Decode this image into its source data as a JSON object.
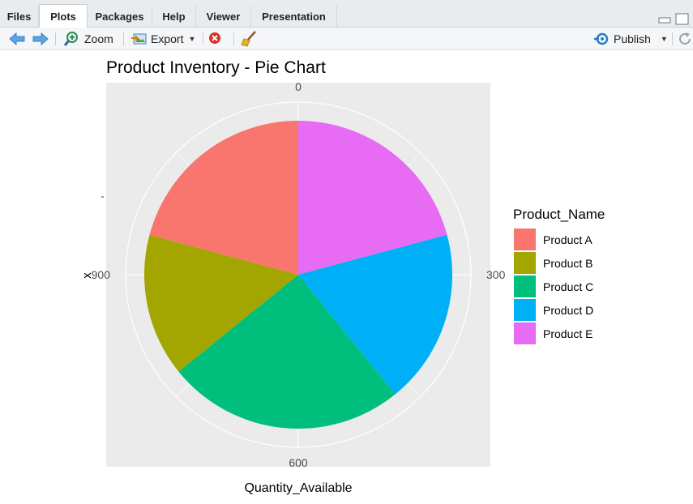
{
  "tabs": [
    {
      "label": "Files",
      "active": false
    },
    {
      "label": "Plots",
      "active": true
    },
    {
      "label": "Packages",
      "active": false
    },
    {
      "label": "Help",
      "active": false
    },
    {
      "label": "Viewer",
      "active": false
    },
    {
      "label": "Presentation",
      "active": false
    }
  ],
  "toolbar": {
    "zoom_label": "Zoom",
    "export_label": "Export",
    "publish_label": "Publish"
  },
  "chart_data": {
    "type": "pie",
    "title": "Product Inventory - Pie Chart",
    "xlabel": "Quantity_Available",
    "ylabel": "x",
    "y_tick_label": "1",
    "legend_title": "Product_Name",
    "legend_position": "right",
    "panel_background": "#ebebeb",
    "grid": true,
    "angle_ticks": [
      {
        "value": 0,
        "label": "0"
      },
      {
        "value": 300,
        "label": "300"
      },
      {
        "value": 600,
        "label": "600"
      },
      {
        "value": 900,
        "label": "900"
      }
    ],
    "total": 1200,
    "slices": [
      {
        "name": "Product E",
        "value": 250,
        "color": "#E76BF3"
      },
      {
        "name": "Product D",
        "value": 220,
        "color": "#00B0F6"
      },
      {
        "name": "Product C",
        "value": 300,
        "color": "#00BF7D"
      },
      {
        "name": "Product B",
        "value": 180,
        "color": "#A3A500"
      },
      {
        "name": "Product A",
        "value": 250,
        "color": "#F8766D"
      }
    ],
    "legend": [
      {
        "name": "Product A",
        "color": "#F8766D"
      },
      {
        "name": "Product B",
        "color": "#A3A500"
      },
      {
        "name": "Product C",
        "color": "#00BF7D"
      },
      {
        "name": "Product D",
        "color": "#00B0F6"
      },
      {
        "name": "Product E",
        "color": "#E76BF3"
      }
    ]
  }
}
